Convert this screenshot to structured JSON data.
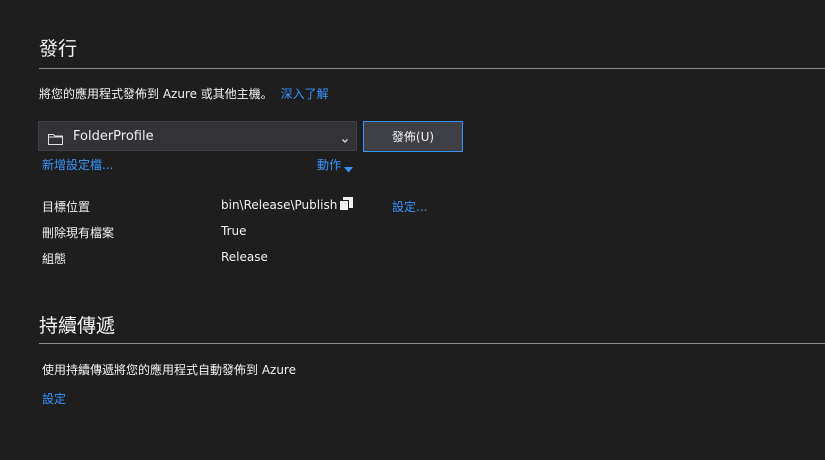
{
  "publish": {
    "title": "發行",
    "description": "將您的應用程式發佈到 Azure 或其他主機。",
    "learn_more": "深入了解",
    "profile": {
      "selected": "FolderProfile",
      "icon": "folder-icon"
    },
    "publish_button": "發佈(U)",
    "new_profile": "新增設定檔...",
    "actions": "動作",
    "properties": [
      {
        "label": "目標位置",
        "value": "bin\\Release\\Publish"
      },
      {
        "label": "刪除現有檔案",
        "value": "True"
      },
      {
        "label": "組態",
        "value": "Release"
      }
    ],
    "settings_link": "設定..."
  },
  "continuous": {
    "title": "持續傳遞",
    "description": "使用持續傳遞將您的應用程式自動發佈到 Azure",
    "settings_link": "設定"
  },
  "colors": {
    "background": "#1e1e1e",
    "link": "#3794ff",
    "text": "#f1f1f1",
    "button_border": "#3794ff"
  }
}
